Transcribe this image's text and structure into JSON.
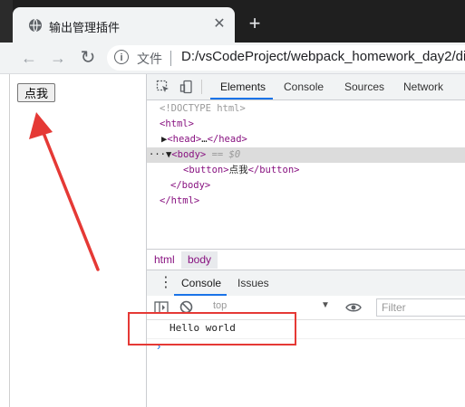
{
  "browser": {
    "tab_title": "输出管理插件",
    "tab_close": "✕",
    "new_tab": "+",
    "nav": {
      "back": "←",
      "forward": "→",
      "reload": "↻"
    },
    "omnibox": {
      "info": "i",
      "scheme_label": "文件",
      "url": "D:/vsCodeProject/webpack_homework_day2/di"
    }
  },
  "page": {
    "button_label": "点我"
  },
  "devtools": {
    "tabs": [
      "Elements",
      "Console",
      "Sources",
      "Network"
    ],
    "active_tab": "Elements",
    "dom": {
      "doctype": "<!DOCTYPE html>",
      "html_open": "<html>",
      "head_open": "<head>",
      "head_ellipsis": "…",
      "head_close": "</head>",
      "body_dots": "···",
      "body_open": "<body>",
      "body_eq": "== $0",
      "button_open": "<button>",
      "button_text": "点我",
      "button_close": "</button>",
      "body_close": "</body>",
      "html_close": "</html>"
    },
    "breadcrumbs": [
      "html",
      "body"
    ],
    "drawer": {
      "tabs": [
        "Console",
        "Issues"
      ],
      "active_tab": "Console"
    },
    "console": {
      "context": "top",
      "filter_placeholder": "Filter",
      "log_message": "Hello world",
      "prompt": "›"
    }
  },
  "colors": {
    "annotation_red": "#e53935",
    "active_tab_underline": "#1a73e8",
    "tag_color": "#881280"
  }
}
